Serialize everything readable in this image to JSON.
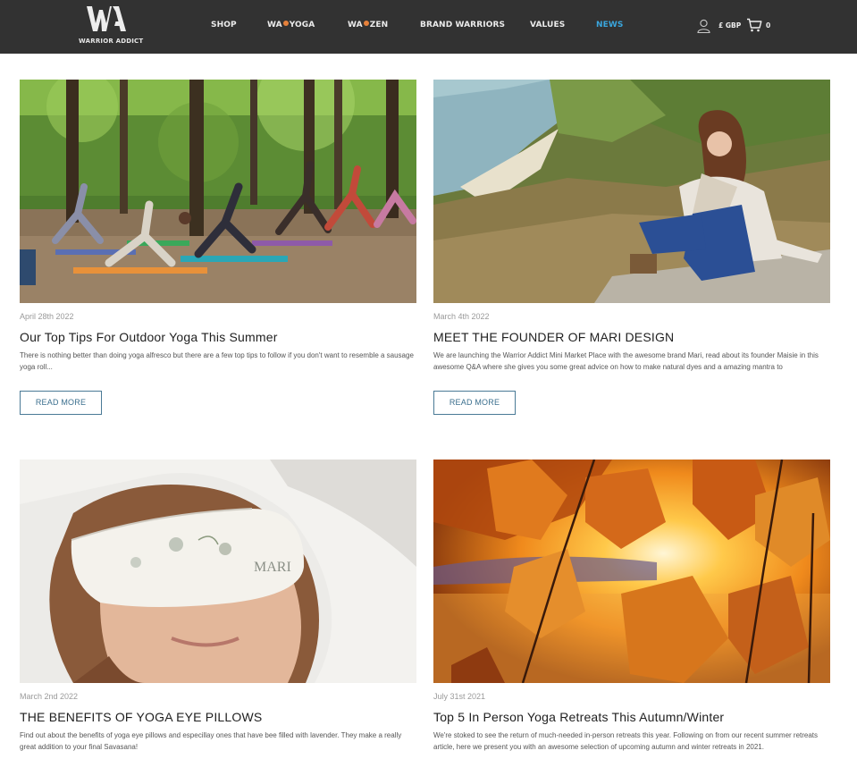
{
  "header": {
    "logo_text": "WARRIOR ADDICT",
    "nav": [
      {
        "label": "SHOP"
      },
      {
        "prefix": "WA",
        "suffix": "YOGA"
      },
      {
        "prefix": "WA",
        "suffix": "ZEN"
      },
      {
        "label": "BRAND WARRIORS"
      },
      {
        "label": "VALUES"
      },
      {
        "label": "NEWS",
        "active": true
      }
    ],
    "currency": "£ GBP",
    "cart_count": "0",
    "colors": {
      "background": "#323232",
      "active": "#3aa6dd",
      "dot": "#e6813b"
    }
  },
  "posts": [
    {
      "date": "April 28th 2022",
      "title": "Our Top Tips For Outdoor Yoga This Summer",
      "excerpt": "There is nothing better than doing yoga alfresco but there are a few top tips to follow if you don't want to resemble a sausage yoga roll...",
      "button": "READ MORE",
      "image": "outdoor-yoga-class-in-forest"
    },
    {
      "date": "March 4th 2022",
      "title": "MEET THE FOUNDER OF MARI DESIGN",
      "excerpt": "We are launching the Warrior Addict Mini Market Place with the awesome brand Mari, read about its founder Maisie in this awesome Q&A where she gives you some great advice on how to make natural dyes and a amazing mantra to",
      "button": "READ MORE",
      "image": "woman-sitting-on-coastal-cliff"
    },
    {
      "date": "March 2nd 2022",
      "title": "THE BENEFITS OF YOGA EYE PILLOWS",
      "excerpt": "Find out about the benefits of yoga eye pillows and especillay ones that have bee filled with lavender. They make a really great addition to your final Savasana!",
      "image": "woman-with-eye-pillow"
    },
    {
      "date": "July 31st 2021",
      "title": "Top 5 In Person Yoga Retreats This Autumn/Winter",
      "excerpt": "We're stoked to see the return of much-needed in-person retreats this year. Following on from our recent summer retreats article, here we present you with an awesome selection of upcoming autumn and winter retreats in 2021.",
      "image": "autumn-leaves-at-sunset"
    }
  ]
}
